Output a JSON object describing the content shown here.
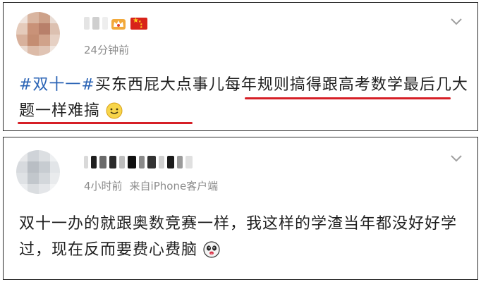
{
  "posts": [
    {
      "timestamp": "24分钟前",
      "source": "",
      "topic": "#双十一#",
      "text_plain": "买东西屁大点事儿",
      "text_highlight": "每年规则搞得跟高考数学最后几大题一样难搞",
      "emoji": "smile-emoji"
    },
    {
      "timestamp": "4小时前",
      "source": "来自iPhone客户端",
      "text": "双十一办的就跟奥数竞赛一样，我这样的学渣当年都没好好学过，现在反而要费心费脑",
      "emoji": "panda-emoji"
    }
  ],
  "colors": {
    "topic": "#2a63b5",
    "highlight_underline": "#d61f26",
    "meta": "#8c8c8c"
  }
}
